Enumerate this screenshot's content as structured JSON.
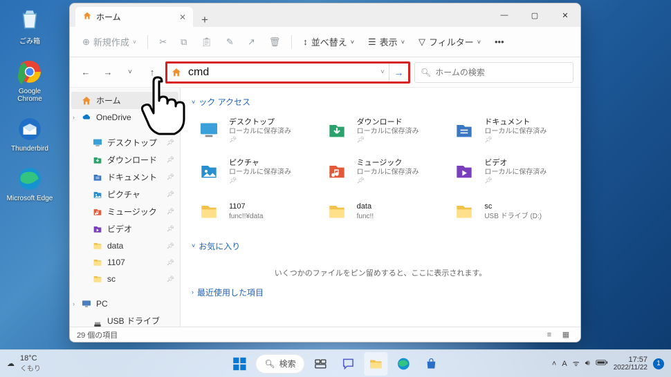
{
  "desktop_icons": [
    {
      "name": "recycle-bin",
      "label": "ごみ箱"
    },
    {
      "name": "google-chrome",
      "label": "Google Chrome"
    },
    {
      "name": "thunderbird",
      "label": "Thunderbird"
    },
    {
      "name": "microsoft-edge",
      "label": "Microsoft Edge"
    }
  ],
  "window": {
    "tab": {
      "title": "ホーム"
    },
    "toolbar": {
      "new": "新規作成",
      "sort": "並べ替え",
      "view": "表示",
      "filter": "フィルター"
    },
    "address_value": "cmd",
    "search_placeholder": "ホームの検索",
    "statusbar": "29 個の項目"
  },
  "sidebar": [
    {
      "type": "home",
      "label": "ホーム",
      "sel": true
    },
    {
      "type": "onedrive",
      "label": "OneDrive",
      "expand": true
    },
    {
      "type": "gap"
    },
    {
      "type": "desktop",
      "label": "デスクトップ",
      "pin": true,
      "lvl": 2
    },
    {
      "type": "downloads",
      "label": "ダウンロード",
      "pin": true,
      "lvl": 2
    },
    {
      "type": "documents",
      "label": "ドキュメント",
      "pin": true,
      "lvl": 2
    },
    {
      "type": "pictures",
      "label": "ピクチャ",
      "pin": true,
      "lvl": 2
    },
    {
      "type": "music",
      "label": "ミュージック",
      "pin": true,
      "lvl": 2
    },
    {
      "type": "videos",
      "label": "ビデオ",
      "pin": true,
      "lvl": 2
    },
    {
      "type": "folder",
      "label": "data",
      "pin": true,
      "lvl": 2
    },
    {
      "type": "folder",
      "label": "1107",
      "pin": true,
      "lvl": 2
    },
    {
      "type": "folder",
      "label": "sc",
      "pin": true,
      "lvl": 2
    },
    {
      "type": "gap"
    },
    {
      "type": "pc",
      "label": "PC",
      "expand": true
    },
    {
      "type": "usb",
      "label": "USB ドライブ (D:)",
      "lvl": 2
    }
  ],
  "content": {
    "quick_access": "ック アクセス",
    "favorites": "お気に入り",
    "recent": "最近使用した項目",
    "empty": "いくつかのファイルをピン留めすると、ここに表示されます。",
    "items": [
      {
        "icon": "desktop",
        "title": "デスクトップ",
        "sub": "ローカルに保存済み",
        "pin": true
      },
      {
        "icon": "downloads",
        "title": "ダウンロード",
        "sub": "ローカルに保存済み",
        "pin": true
      },
      {
        "icon": "documents",
        "title": "ドキュメント",
        "sub": "ローカルに保存済み",
        "pin": true
      },
      {
        "icon": "pictures",
        "title": "ピクチャ",
        "sub": "ローカルに保存済み",
        "pin": true
      },
      {
        "icon": "music",
        "title": "ミュージック",
        "sub": "ローカルに保存済み",
        "pin": true
      },
      {
        "icon": "videos",
        "title": "ビデオ",
        "sub": "ローカルに保存済み",
        "pin": true
      },
      {
        "icon": "folder",
        "title": "1107",
        "sub": "func!!¥data"
      },
      {
        "icon": "folder",
        "title": "data",
        "sub": "func!!"
      },
      {
        "icon": "folder",
        "title": "sc",
        "sub": "USB ドライブ (D:)"
      }
    ]
  },
  "taskbar": {
    "weather_temp": "18°C",
    "weather_label": "くもり",
    "search": "検索",
    "ime": "A",
    "time": "17:57",
    "date": "2022/11/22",
    "badge": "1"
  },
  "colors": {
    "desktop": "#3aa0d9",
    "downloads": "#29a36b",
    "documents": "#3a78c4",
    "pictures": "#2a8fd0",
    "music": "#e25a3a",
    "videos": "#7a3fbd",
    "folder": "#f2c24b",
    "onedrive": "#0b78c8",
    "pc": "#4a7fbc",
    "usb": "#555"
  }
}
